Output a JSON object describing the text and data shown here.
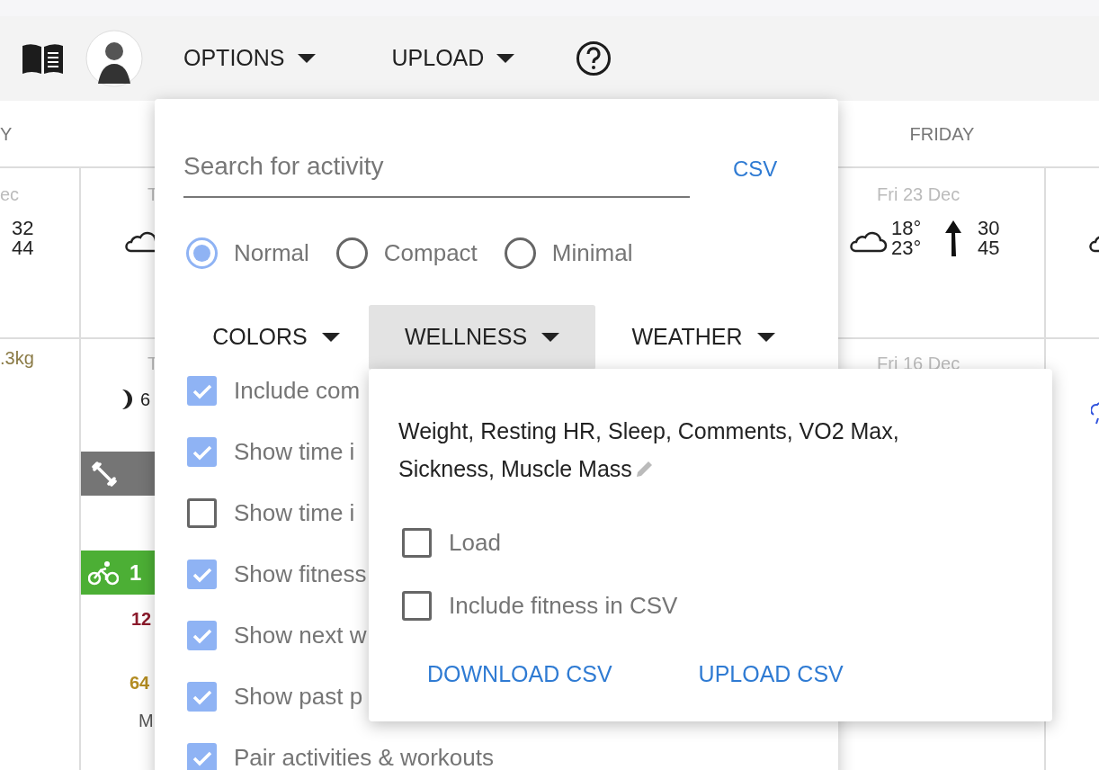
{
  "toolbar": {
    "menus": [
      {
        "label": "OPTIONS"
      },
      {
        "label": "UPLOAD"
      }
    ]
  },
  "calendar": {
    "headers": [
      "Y",
      "FRIDAY"
    ],
    "left_column": {
      "row1": {
        "date": "ec",
        "values": [
          "32",
          "44"
        ]
      },
      "row2": {
        "weight": ".3kg"
      }
    },
    "second_column": {
      "row1": {
        "date": "T"
      },
      "row2": {
        "date": "T",
        "moon": "6",
        "workout": {
          "color": "#757575"
        },
        "ride": {
          "label": "1",
          "color": "#4caf35"
        },
        "load": "12",
        "fitness": "64",
        "note": "M"
      }
    },
    "friday": {
      "row1": {
        "date": "Fri 23 Dec",
        "temps": [
          "18°",
          "23°"
        ],
        "wind": [
          "30",
          "45"
        ]
      },
      "row2": {
        "date": "Fri 16 Dec"
      }
    }
  },
  "options_menu": {
    "search": {
      "placeholder": "Search for activity"
    },
    "csv_link": "CSV",
    "layouts": [
      {
        "label": "Normal",
        "selected": true
      },
      {
        "label": "Compact",
        "selected": false
      },
      {
        "label": "Minimal",
        "selected": false
      }
    ],
    "dropdowns": [
      {
        "label": "COLORS",
        "expanded": false
      },
      {
        "label": "WELLNESS",
        "expanded": true
      },
      {
        "label": "WEATHER",
        "expanded": false
      }
    ],
    "checkboxes": [
      {
        "label": "Include com",
        "checked": true
      },
      {
        "label": "Show time i",
        "checked": true
      },
      {
        "label": "Show time i",
        "checked": false
      },
      {
        "label": "Show fitness",
        "checked": true
      },
      {
        "label": "Show next w",
        "checked": true
      },
      {
        "label": "Show past p",
        "checked": true
      },
      {
        "label": "Pair activities & workouts",
        "checked": true
      }
    ]
  },
  "wellness_menu": {
    "fields": "Weight, Resting HR, Sleep, Comments, VO2 Max, Sickness, Muscle Mass",
    "checkboxes": [
      {
        "label": "Load",
        "checked": false
      },
      {
        "label": "Include fitness in CSV",
        "checked": false
      }
    ],
    "buttons": [
      "DOWNLOAD CSV",
      "UPLOAD CSV"
    ]
  }
}
